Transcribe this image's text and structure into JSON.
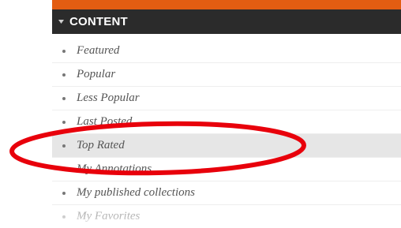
{
  "panel": {
    "accent_color": "#e35d12",
    "header_bg": "#2b2b2b",
    "header": {
      "title": "CONTENT",
      "toggle_icon": "triangle-down-icon"
    },
    "items": [
      {
        "label": "Featured"
      },
      {
        "label": "Popular"
      },
      {
        "label": "Less Popular"
      },
      {
        "label": "Last Posted"
      },
      {
        "label": "Top Rated",
        "selected": true
      },
      {
        "label": "My Annotations"
      },
      {
        "label": "My published collections"
      },
      {
        "label": "My Favorites"
      }
    ]
  },
  "annotation": {
    "shape": "ellipse",
    "color": "#e8000b",
    "target": "Top Rated"
  }
}
